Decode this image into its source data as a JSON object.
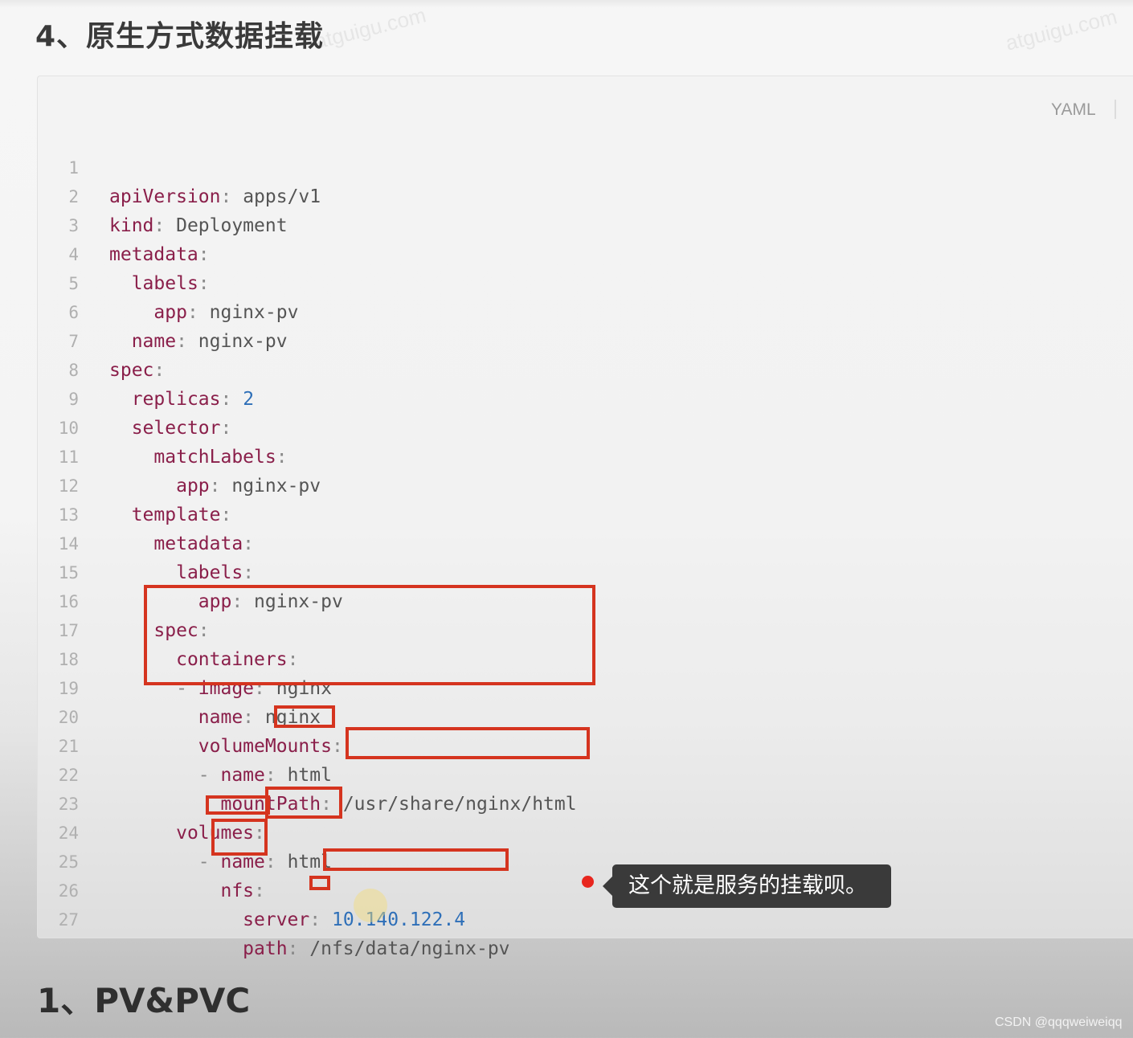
{
  "heading": "4、原生方式数据挂载",
  "watermark": "atguigu.com",
  "code_block": {
    "language": "YAML",
    "lines": [
      {
        "num": "1",
        "key": "apiVersion",
        "value": "apps/v1"
      },
      {
        "num": "2",
        "key": "kind",
        "value": "Deployment"
      },
      {
        "num": "3",
        "key": "metadata",
        "value": ""
      },
      {
        "num": "4",
        "key": "labels",
        "value": ""
      },
      {
        "num": "5",
        "key": "app",
        "value": "nginx-pv"
      },
      {
        "num": "6",
        "key": "name",
        "value": "nginx-pv"
      },
      {
        "num": "7",
        "key": "spec",
        "value": ""
      },
      {
        "num": "8",
        "key": "replicas",
        "value": "2"
      },
      {
        "num": "9",
        "key": "selector",
        "value": ""
      },
      {
        "num": "10",
        "key": "matchLabels",
        "value": ""
      },
      {
        "num": "11",
        "key": "app",
        "value": "nginx-pv"
      },
      {
        "num": "12",
        "key": "template",
        "value": ""
      },
      {
        "num": "13",
        "key": "metadata",
        "value": ""
      },
      {
        "num": "14",
        "key": "labels",
        "value": ""
      },
      {
        "num": "15",
        "key": "app",
        "value": "nginx-pv"
      },
      {
        "num": "16",
        "key": "spec",
        "value": ""
      },
      {
        "num": "17",
        "key": "containers",
        "value": ""
      },
      {
        "num": "18",
        "key": "image",
        "value": "nginx"
      },
      {
        "num": "19",
        "key": "name",
        "value": "nginx"
      },
      {
        "num": "20",
        "key": "volumeMounts",
        "value": ""
      },
      {
        "num": "21",
        "key": "name",
        "value": "html"
      },
      {
        "num": "22",
        "key": "mountPath",
        "value": "/usr/share/nginx/html"
      },
      {
        "num": "23",
        "key": "volumes",
        "value": ""
      },
      {
        "num": "24",
        "key": "name",
        "value": "html"
      },
      {
        "num": "25",
        "key": "nfs",
        "value": ""
      },
      {
        "num": "26",
        "key": "server",
        "value": "10.140.122.4"
      },
      {
        "num": "27",
        "key": "path",
        "value": "/nfs/data/nginx-pv"
      }
    ]
  },
  "tooltip": "这个就是服务的挂载呗。",
  "next_heading": "1、PV&PVC",
  "footer": "CSDN @qqqweiweiqq",
  "colors": {
    "key": "#8a1f4a",
    "number": "#2e6fb8",
    "annotation_box": "#d5341f",
    "tooltip_bg": "#3a3a3a",
    "marker": "#e8261e"
  }
}
